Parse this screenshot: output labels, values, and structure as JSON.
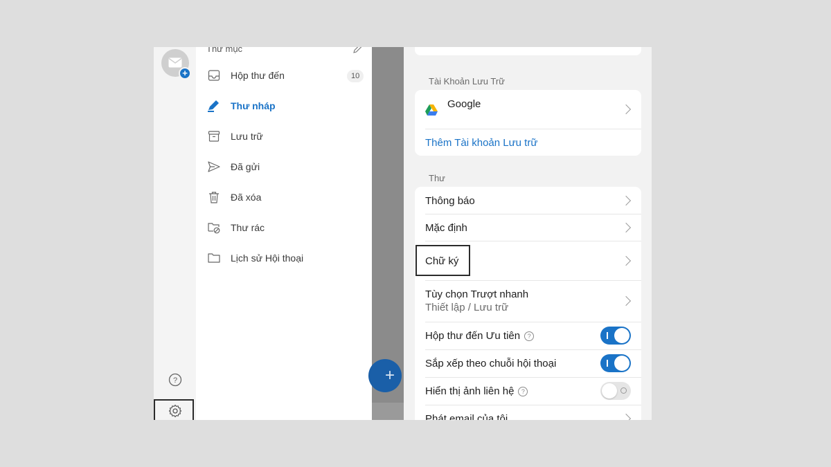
{
  "folders": {
    "header": "Thư mục",
    "items": [
      {
        "label": "Hộp thư đến",
        "icon": "inbox-icon",
        "count": "10"
      },
      {
        "label": "Thư nháp",
        "icon": "drafts-icon",
        "active": true
      },
      {
        "label": "Lưu trữ",
        "icon": "archive-icon"
      },
      {
        "label": "Đã gửi",
        "icon": "sent-icon"
      },
      {
        "label": "Đã xóa",
        "icon": "trash-icon"
      },
      {
        "label": "Thư rác",
        "icon": "junk-icon"
      },
      {
        "label": "Lịch sử Hội thoại",
        "icon": "folder-icon"
      }
    ]
  },
  "fab": {
    "label": "+"
  },
  "settings": {
    "storage": {
      "section_title": "Tài Khoản Lưu Trữ",
      "google_label": "Google",
      "add_link": "Thêm Tài khoản Lưu trữ"
    },
    "mail": {
      "section_title": "Thư",
      "notifications": "Thông báo",
      "defaults": "Mặc định",
      "signature": "Chữ ký",
      "swipe_title": "Tùy chọn Trượt nhanh",
      "swipe_sub": "Thiết lập / Lưu trữ",
      "focused_inbox": "Hộp thư đến Ưu tiên",
      "thread_sort": "Sắp xếp theo chuỗi hội thoại",
      "contact_photos": "Hiển thị ảnh liên hệ",
      "play_email": "Phát email của tôi"
    },
    "toggles": {
      "focused_inbox": true,
      "thread_sort": true,
      "contact_photos": false
    }
  },
  "colors": {
    "accent": "#1a73c7",
    "bg": "#f2f2f2"
  }
}
